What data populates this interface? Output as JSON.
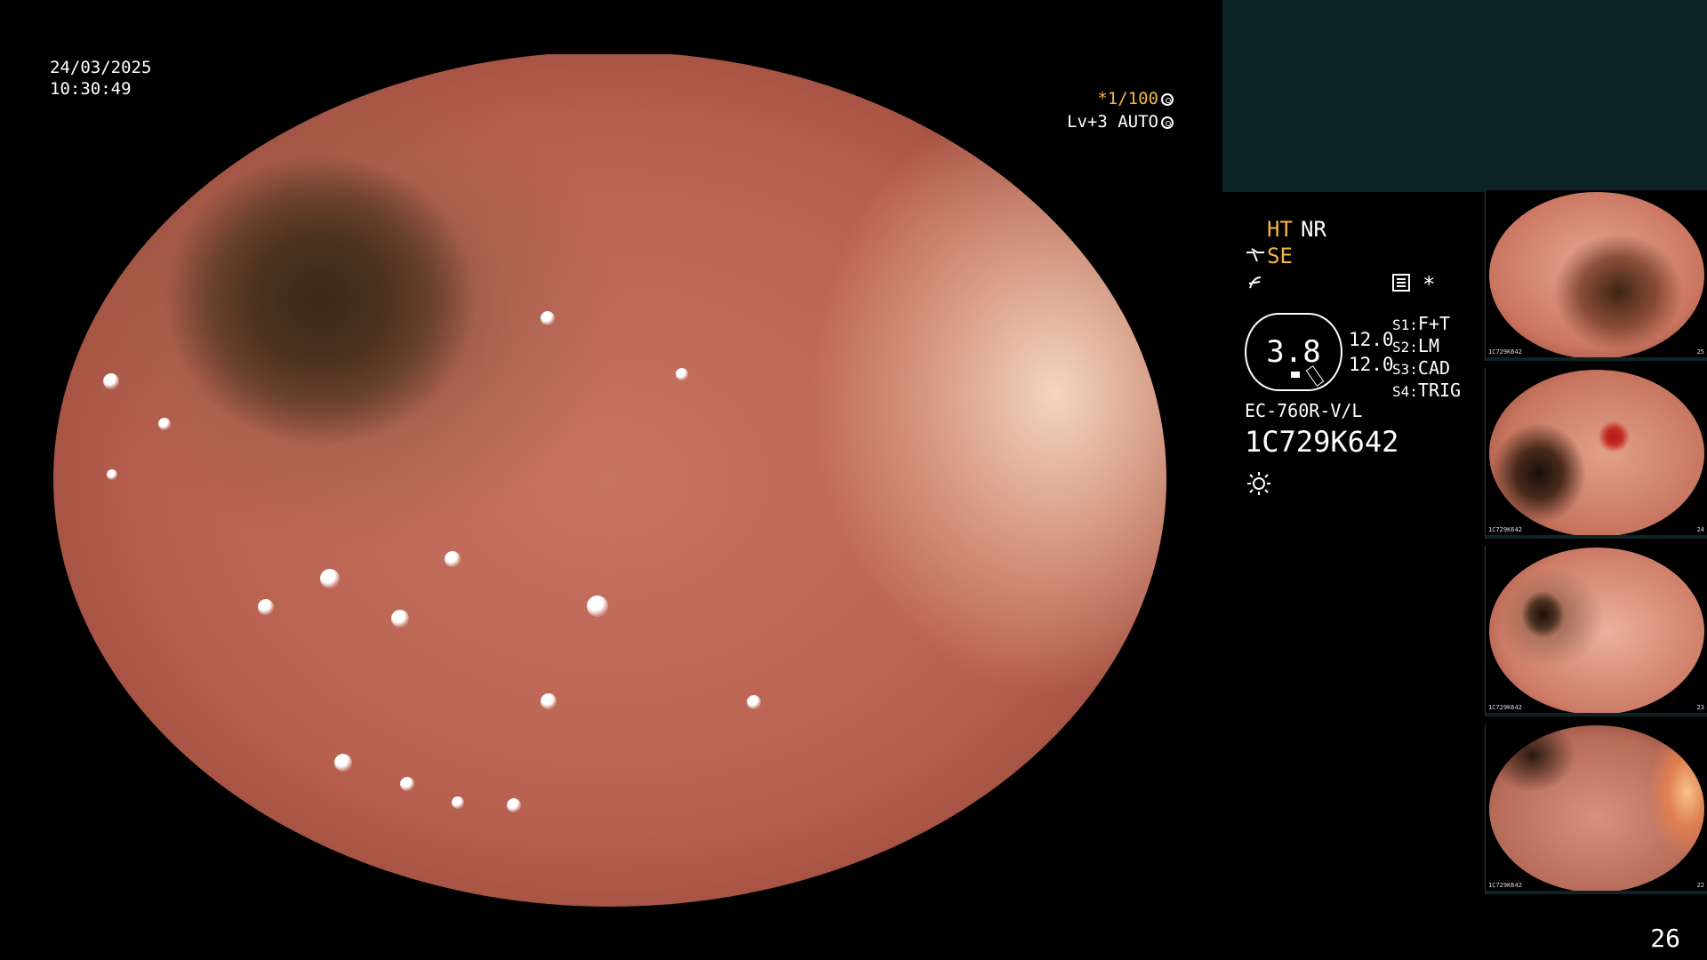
{
  "overlay": {
    "date": "24/03/2025",
    "time": "10:30:49",
    "shutter_prefix": "*",
    "shutter": "1/100",
    "level": "Lv+3 AUTO"
  },
  "panel": {
    "ht": "HT",
    "nr": "NR",
    "se": "SE",
    "asterisk": "*",
    "badge_value": "3.8",
    "val1": "12.0",
    "val2": "12.0",
    "s1_label": "S1:",
    "s1": "F+T",
    "s2_label": "S2:",
    "s2": "LM",
    "s3_label": "S3:",
    "s3": "CAD",
    "s4_label": "S4:",
    "s4": "TRIG",
    "scope_model": "EC-760R-V/L",
    "serial": "1C729K642",
    "icons": [
      "scope-bend-icon",
      "fn-icon",
      "settings-list-icon",
      "light-sun-icon"
    ]
  },
  "thumbnails": [
    {
      "label": "1C729K642",
      "num": "25"
    },
    {
      "label": "1C729K642",
      "num": "24"
    },
    {
      "label": "1C729K642",
      "num": "23"
    },
    {
      "label": "1C729K642",
      "num": "22"
    }
  ],
  "page_number": "26",
  "colors": {
    "accent_yellow": "#f5b642",
    "panel_teal": "#0d2426"
  }
}
